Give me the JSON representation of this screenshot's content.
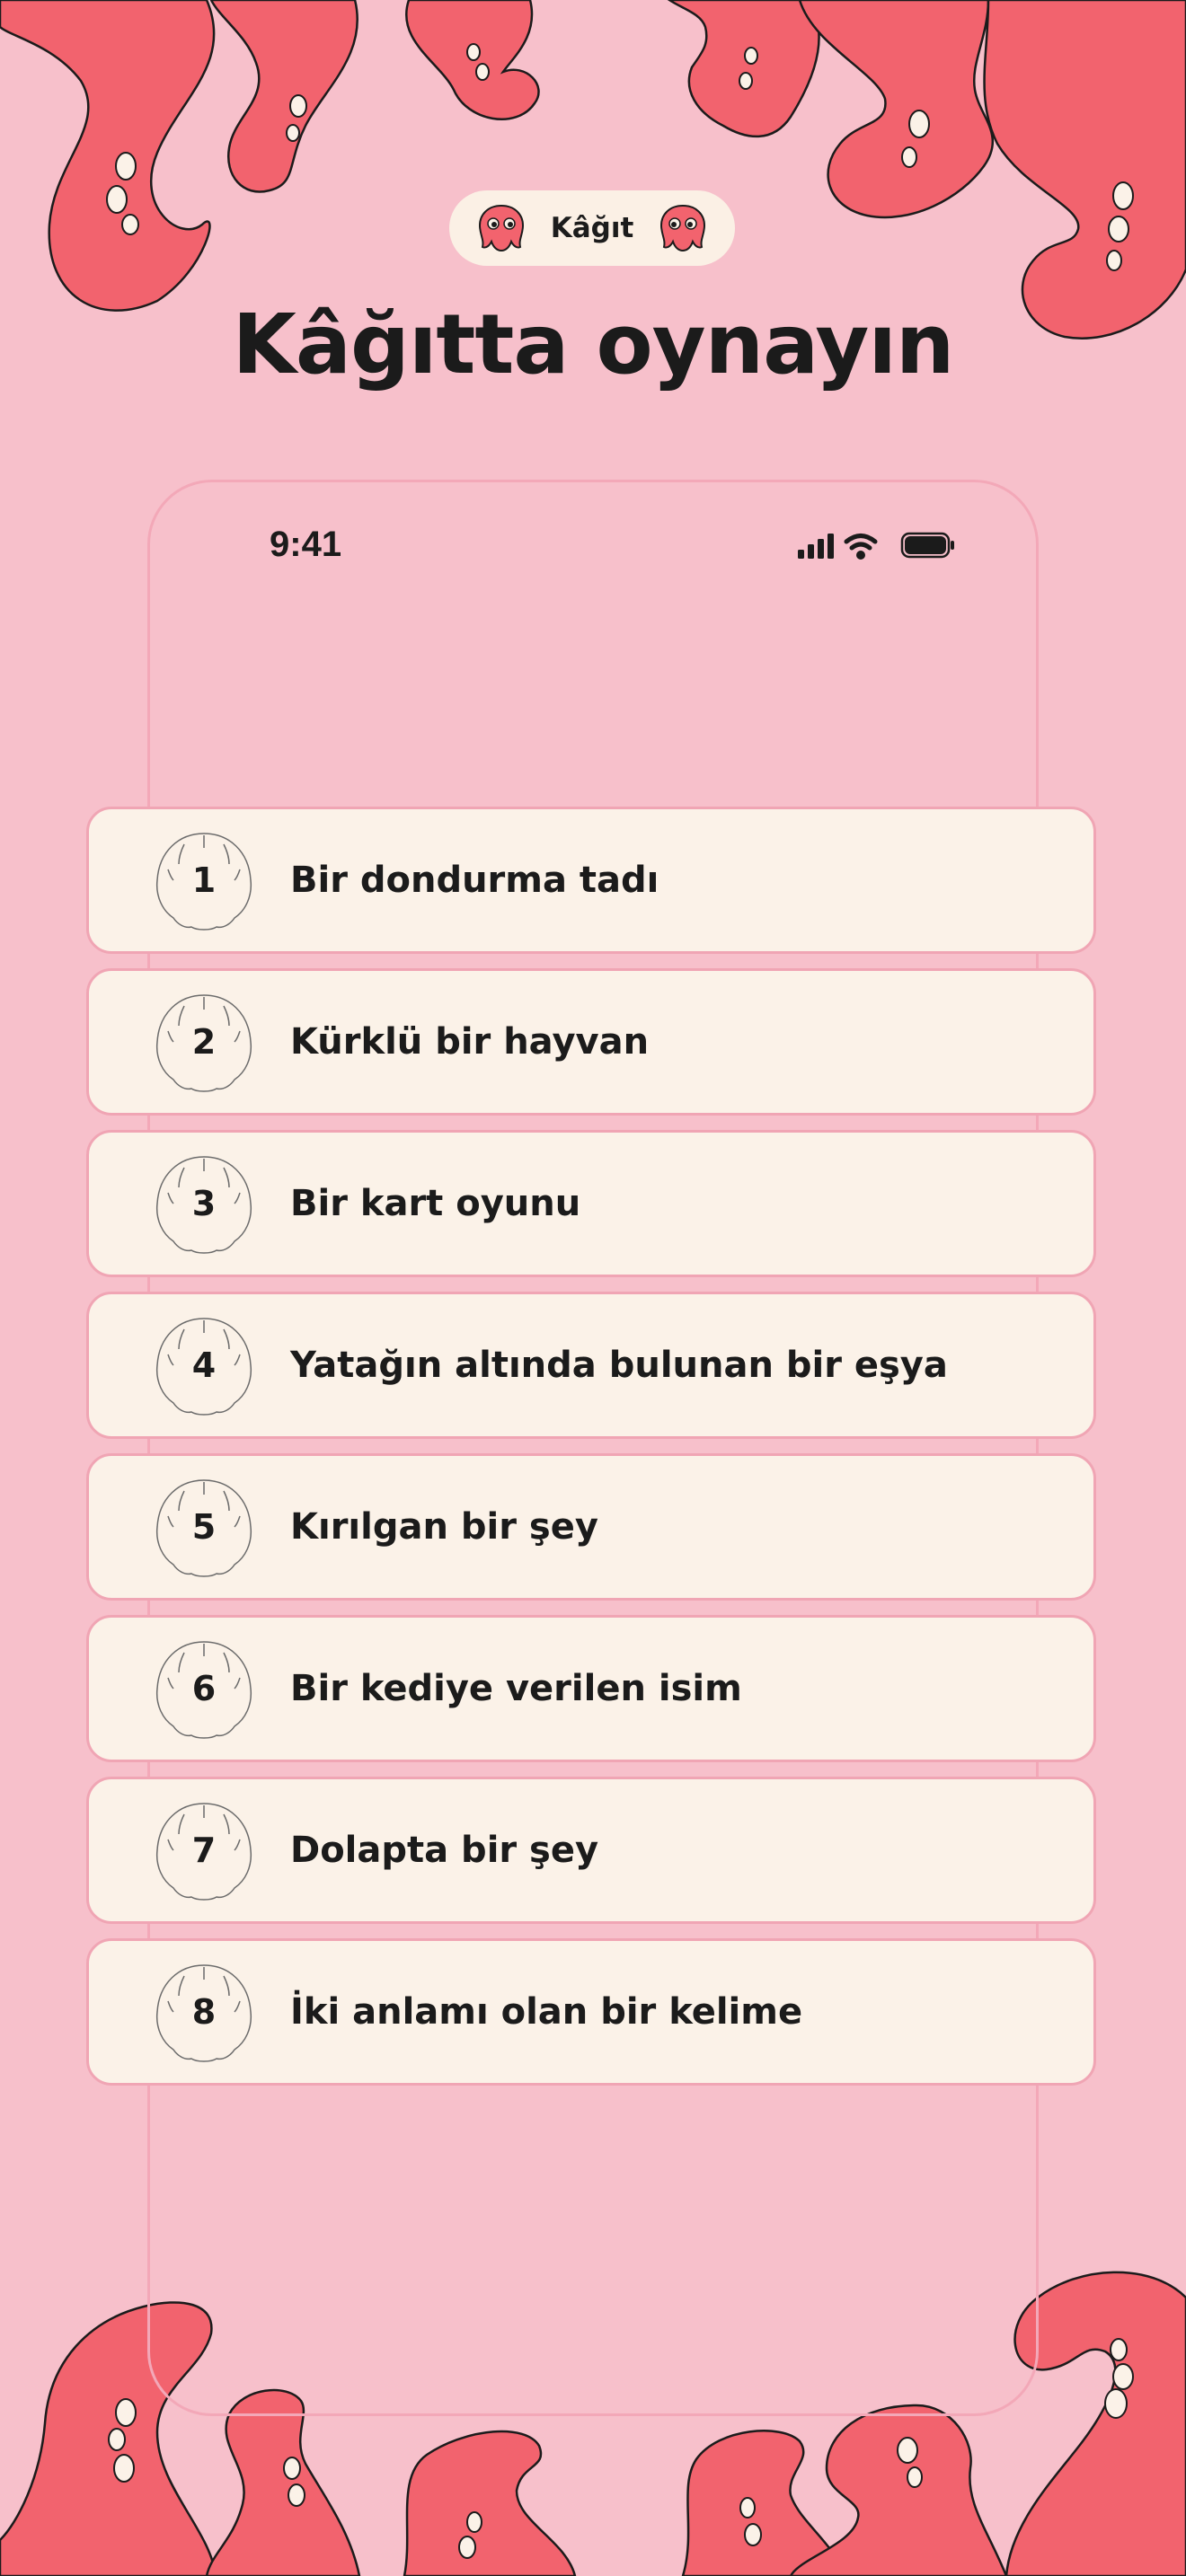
{
  "header": {
    "brand_label": "Kâğıt",
    "headline": "Kâğıtta oynayın"
  },
  "status_bar": {
    "time": "9:41"
  },
  "prompts": [
    {
      "number": "1",
      "text": "Bir dondurma tadı"
    },
    {
      "number": "2",
      "text": "Kürklü bir hayvan"
    },
    {
      "number": "3",
      "text": "Bir kart oyunu"
    },
    {
      "number": "4",
      "text": "Yatağın altında bulunan bir eşya"
    },
    {
      "number": "5",
      "text": "Kırılgan bir şey"
    },
    {
      "number": "6",
      "text": "Bir kediye verilen isim"
    },
    {
      "number": "7",
      "text": "Dolapta bir şey"
    },
    {
      "number": "8",
      "text": "İki anlamı olan bir kelime"
    }
  ],
  "icons": {
    "brand_left": "octopus-icon",
    "brand_right": "octopus-icon",
    "signal": "cellular-signal-icon",
    "wifi": "wifi-icon",
    "battery": "battery-icon",
    "badge": "shell-icon"
  },
  "colors": {
    "background": "#f7c0cb",
    "tentacle": "#f2636e",
    "card": "#fbf2e8",
    "card_border": "#f0a5b4",
    "text": "#1b1b1b"
  }
}
